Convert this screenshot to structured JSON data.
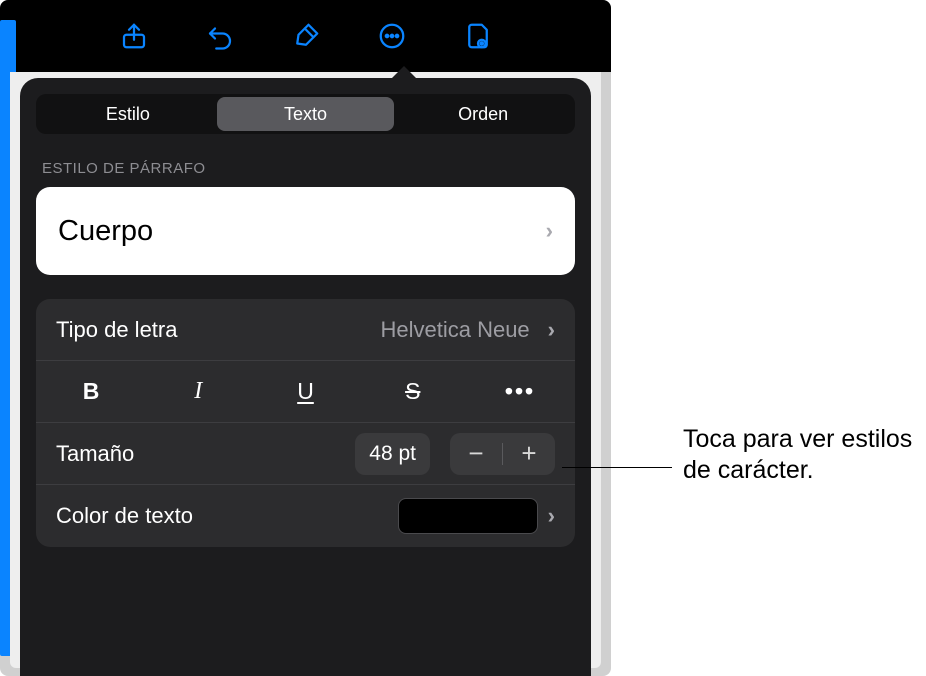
{
  "toolbar_icons": [
    "share-icon",
    "undo-icon",
    "format-icon",
    "more-icon",
    "view-icon"
  ],
  "tabs": {
    "style": "Estilo",
    "text": "Texto",
    "order": "Orden"
  },
  "section_label": "Estilo de párrafo",
  "paragraph_style": "Cuerpo",
  "font": {
    "label": "Tipo de letra",
    "value": "Helvetica Neue"
  },
  "format_buttons": {
    "bold": "B",
    "italic": "I",
    "underline": "U",
    "strike": "S",
    "more": "•••"
  },
  "size": {
    "label": "Tamaño",
    "value": "48 pt",
    "minus": "−",
    "plus": "+"
  },
  "text_color": {
    "label": "Color de texto",
    "value": "#000000"
  },
  "callout": "Toca para ver estilos de carácter."
}
